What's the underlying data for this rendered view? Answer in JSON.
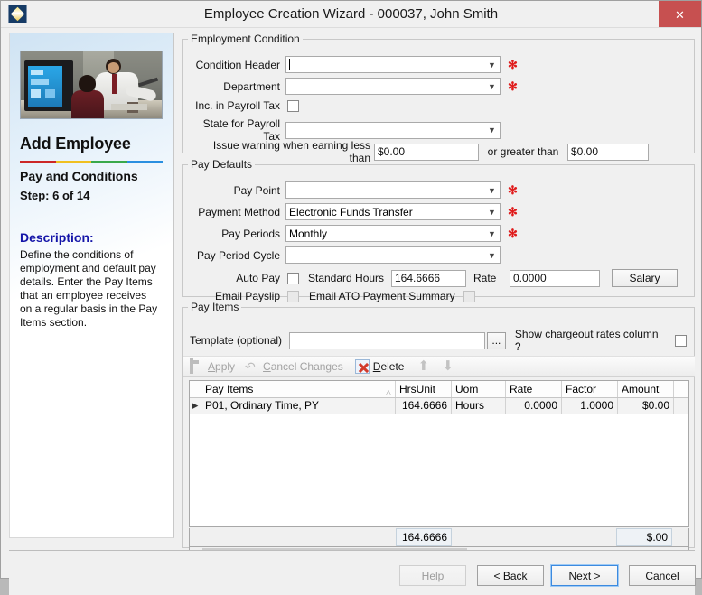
{
  "window": {
    "title": "Employee Creation Wizard  - 000037, John Smith",
    "icon": "app-diamond-icon",
    "close_label": "✕"
  },
  "sidebar": {
    "photo_alt": "office-workers-photo",
    "heading": "Add Employee",
    "rule_colors": [
      "#cc2727",
      "#f0c020",
      "#3aa94b",
      "#2a8fe0"
    ],
    "step_title": "Pay and Conditions",
    "step_label": "Step: 6 of 14",
    "description_label": "Description:",
    "description_text": "Define the conditions of employment and default pay details. Enter the Pay Items that an employee receives on a regular basis in the Pay Items section."
  },
  "employment_condition": {
    "legend": "Employment Condition",
    "condition_header": {
      "label": "Condition Header",
      "value": "",
      "required": "✻"
    },
    "department": {
      "label": "Department",
      "value": "",
      "required": "✻"
    },
    "inc_payroll_tax": {
      "label": "Inc. in Payroll Tax",
      "checked": false
    },
    "state_payroll_tax": {
      "label": "State for Payroll Tax",
      "value": ""
    },
    "warning_prefix": "Issue warning when earning less than",
    "warning_less_value": "$0.00",
    "warning_middle": "or greater than",
    "warning_greater_value": "$0.00"
  },
  "pay_defaults": {
    "legend": "Pay Defaults",
    "pay_point": {
      "label": "Pay Point",
      "value": "",
      "required": "✻"
    },
    "payment_method": {
      "label": "Payment Method",
      "value": "Electronic Funds Transfer",
      "required": "✻"
    },
    "pay_periods": {
      "label": "Pay Periods",
      "value": "Monthly",
      "required": "✻"
    },
    "pay_period_cycle": {
      "label": "Pay Period Cycle",
      "value": ""
    },
    "auto_pay": {
      "label": "Auto Pay",
      "checked": false
    },
    "standard_hours": {
      "label": "Standard Hours",
      "value": "164.6666"
    },
    "rate": {
      "label": "Rate",
      "value": "0.0000"
    },
    "salary_button": "Salary",
    "email_payslip": {
      "label": "Email Payslip",
      "checked": false,
      "disabled": true
    },
    "email_ato": {
      "label": "Email ATO Payment Summary",
      "checked": false,
      "disabled": true
    }
  },
  "pay_items": {
    "legend": "Pay Items",
    "template_label": "Template (optional)",
    "template_value": "",
    "browse_button": "...",
    "chargeout_label": "Show chargeout rates column ?",
    "chargeout_checked": false,
    "toolbar": [
      {
        "name": "apply",
        "label": "Apply",
        "icon": "save-icon",
        "enabled": false
      },
      {
        "name": "cancel-changes",
        "label": "Cancel Changes",
        "icon": "undo-icon",
        "enabled": false
      },
      {
        "name": "delete",
        "label": "Delete",
        "icon": "delete-red-x-icon",
        "enabled": true
      },
      {
        "name": "move-up",
        "label": "",
        "icon": "arrow-up-icon",
        "enabled": false
      },
      {
        "name": "move-down",
        "label": "",
        "icon": "arrow-down-icon",
        "enabled": false
      }
    ],
    "columns": [
      "Pay Items",
      "HrsUnit",
      "Uom",
      "Rate",
      "Factor",
      "Amount"
    ],
    "sort_indicator": "△",
    "rows": [
      {
        "indicator": "▶",
        "pay_item": "P01, Ordinary Time, PY",
        "hrsunit": "164.6666",
        "uom": "Hours",
        "rate": "0.0000",
        "factor": "1.0000",
        "amount": "$0.00"
      }
    ],
    "footer_totals": {
      "hrsunit": "164.6666",
      "amount": "$.00"
    },
    "scroll_left": "‹",
    "scroll_right": "›"
  },
  "footer_buttons": {
    "help": "Help",
    "back": "< Back",
    "next": "Next >",
    "cancel": "Cancel"
  }
}
